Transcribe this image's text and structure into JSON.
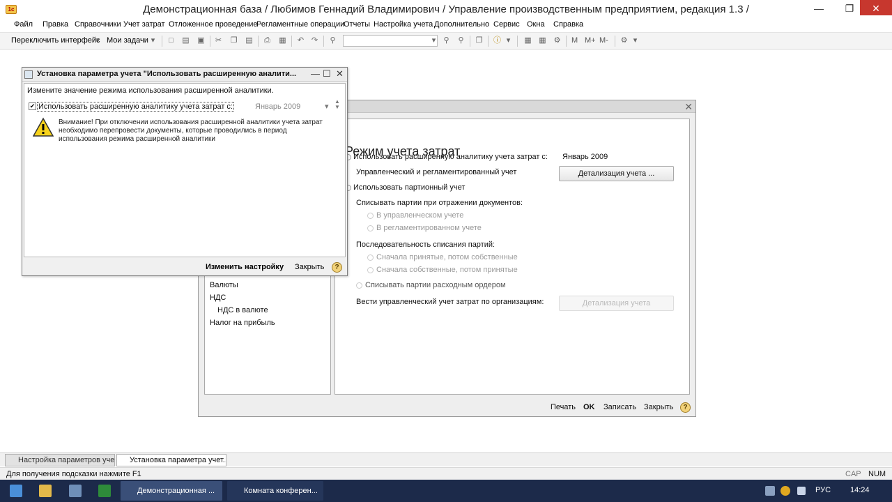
{
  "app": {
    "title": "Демонстрационная база / Любимов Геннадий Владимирович / Управление производственным предприятием, редакция 1.3 /",
    "logo_text": "1c"
  },
  "menu": [
    "Файл",
    "Правка",
    "Справочники",
    "Учет затрат",
    "Отложенное проведение",
    "Регламентные операции",
    "Отчеты",
    "Настройка учета",
    "Дополнительно",
    "Сервис",
    "Окна",
    "Справка"
  ],
  "toolbar": {
    "switch_interface": "Переключить интерфейс",
    "my_tasks": "Мои задачи",
    "m_labels": [
      "M",
      "M+",
      "M-"
    ]
  },
  "main_form": {
    "heading": "Режим учета затрат",
    "tree": [
      "Валюты",
      "НДС",
      "НДС в валюте",
      "Налог на прибыль"
    ],
    "use_extended": "Использовать расширенную аналитику учета затрат с:",
    "date_value": "Январь 2009",
    "mgmt_reg": "Управленческий и регламентированный учет",
    "detail_btn": "Детализация учета ...",
    "use_batch": "Использовать партионный учет",
    "write_off_title": "Списывать партии при отражении документов:",
    "in_mgmt": "В управленческом учете",
    "in_reg": "В регламентированном учете",
    "sequence_title": "Последовательность списания партий:",
    "seq_first": "Сначала принятые, потом собственные",
    "seq_second": "Сначала собственные, потом принятые",
    "expense_order": "Списывать партии расходным ордером",
    "by_orgs": "Вести управленческий учет затрат по организациям:",
    "detail_btn2": "Детализация учета",
    "footer": {
      "print": "Печать",
      "ok": "OK",
      "save": "Записать",
      "close": "Закрыть",
      "help": "?"
    }
  },
  "dialog": {
    "title": "Установка параметра учета \"Использовать расширенную аналити...",
    "instruction": "Измените значение режима использования расширенной аналитики.",
    "checkbox_label": "Использовать расширенную аналитику учета затрат с:",
    "checkbox_mark": "✔",
    "date_value": "Январь 2009",
    "warning": "Внимание! При отключении использования расширенной аналитики учета затрат необходимо перепровести документы, которые проводились в период использования режима расширенной аналитики",
    "change_btn": "Изменить настройку",
    "close_btn": "Закрыть",
    "help": "?"
  },
  "app_tabs": [
    "Настройка параметров уче...",
    "Установка параметра учет..."
  ],
  "status": {
    "hint": "Для получения подсказки нажмите F1",
    "cap": "CAP",
    "num": "NUM"
  },
  "taskbar": {
    "buttons": [
      "Демонстрационная ...",
      "Комната конферен..."
    ],
    "lang": "РУС",
    "time": "14:24"
  }
}
